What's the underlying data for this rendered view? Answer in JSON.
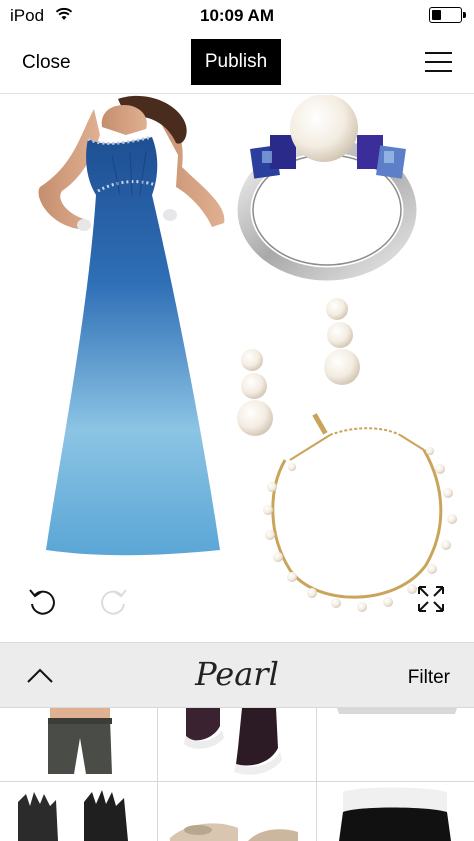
{
  "status_bar": {
    "carrier": "iPod",
    "time": "10:09 AM",
    "battery_level": 0.3
  },
  "nav": {
    "close_label": "Close",
    "publish_label": "Publish",
    "menu_icon": "hamburger-menu-icon"
  },
  "canvas": {
    "items": [
      "ombre strapless gown",
      "pearl sapphire ring",
      "pearl drop earrings",
      "pearl collar necklace"
    ],
    "undo_icon": "undo-icon",
    "redo_icon": "redo-icon",
    "expand_icon": "expand-icon"
  },
  "search": {
    "query": "Pearl",
    "filter_label": "Filter",
    "toggle_icon": "chevron-up-icon"
  },
  "results": {
    "items": [
      "grey jeans",
      "black sneakers",
      "white item",
      "black leather gloves",
      "metallic flats",
      "black item"
    ]
  },
  "colors": {
    "publish_bg": "#000000",
    "search_bar_bg": "#ececec",
    "dress_top": "#1f4e8f",
    "dress_bottom": "#6fb3da"
  }
}
